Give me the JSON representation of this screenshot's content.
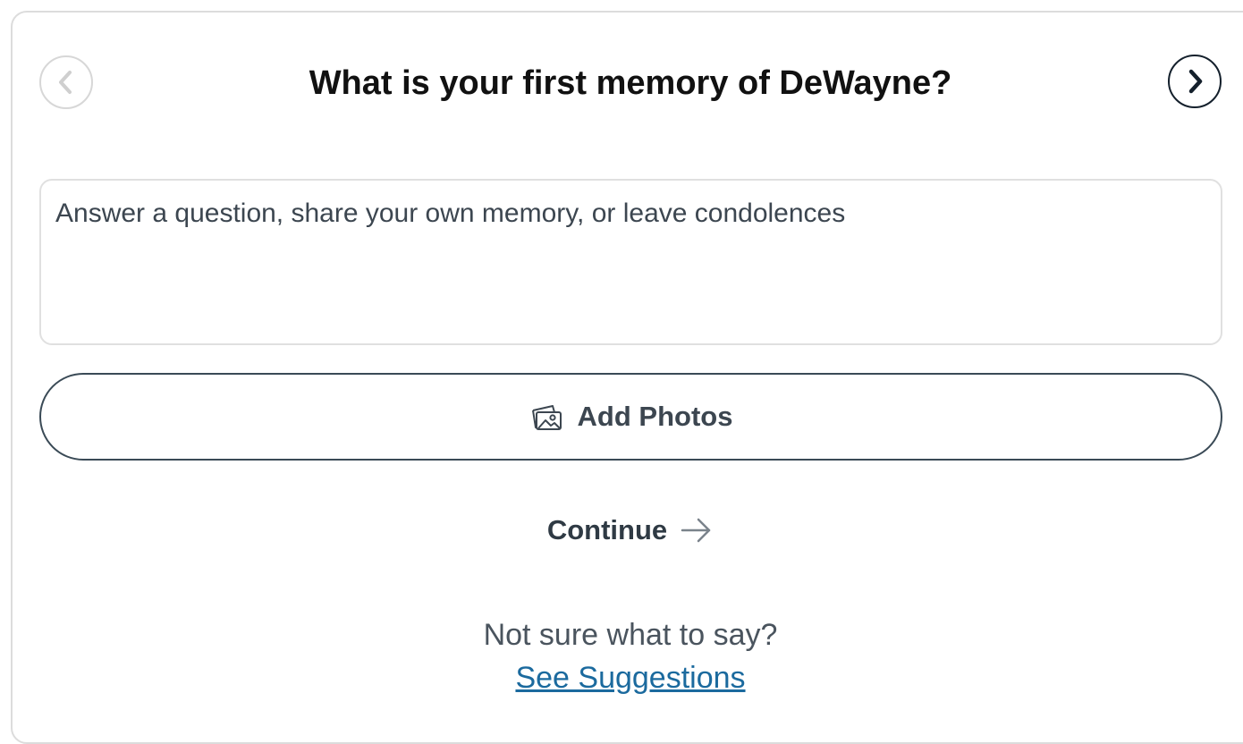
{
  "header": {
    "question": "What is your first memory of DeWayne?",
    "prev_icon": "chevron-left-icon",
    "next_icon": "chevron-right-icon"
  },
  "memory_input": {
    "value": "",
    "placeholder": "Answer a question, share your own memory, or leave condolences"
  },
  "add_photos": {
    "label": "Add Photos",
    "icon": "photos-icon"
  },
  "continue": {
    "label": "Continue",
    "icon": "arrow-right-icon"
  },
  "help": {
    "prompt": "Not sure what to say?",
    "link_label": "See Suggestions"
  },
  "colors": {
    "text_dark": "#111111",
    "text_muted": "#4a545e",
    "link": "#1b6a9e",
    "border_light": "#dcdcdc",
    "border_dark": "#3a4a56"
  }
}
